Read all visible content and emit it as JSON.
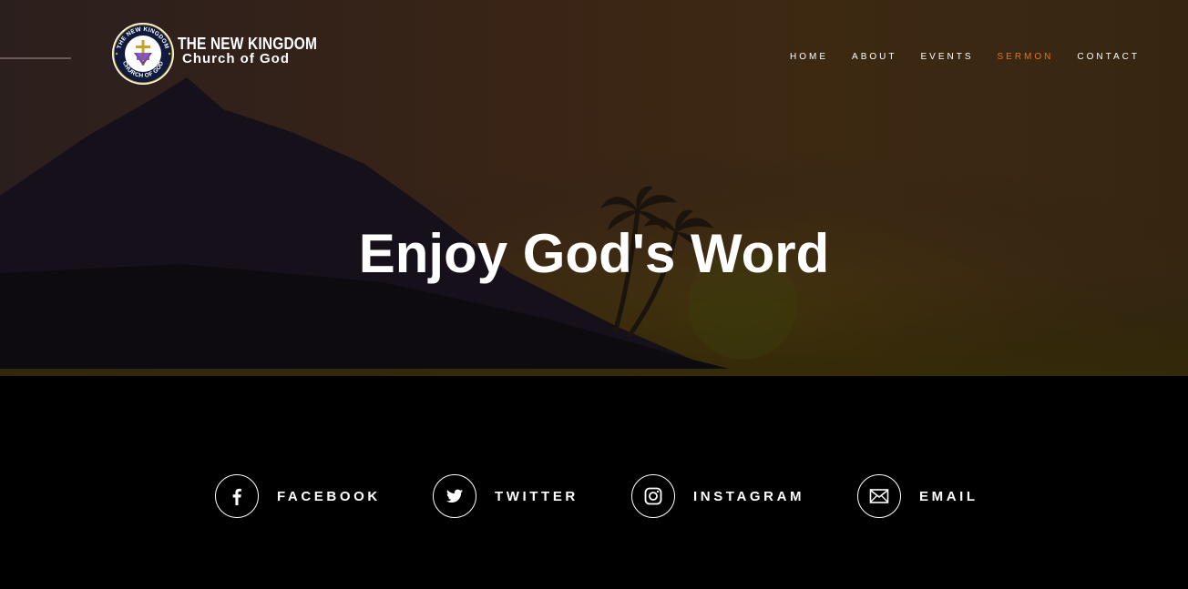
{
  "brand": {
    "line1": "THE NEW KINGDOM",
    "line2": "Church of God",
    "emblem_text": "THE NEW KINGDOM · CHURCH OF GOD"
  },
  "nav": {
    "items": [
      {
        "label": "HOME",
        "active": false
      },
      {
        "label": "ABOUT",
        "active": false
      },
      {
        "label": "EVENTS",
        "active": false
      },
      {
        "label": "SERMON",
        "active": true
      },
      {
        "label": "CONTACT",
        "active": false
      }
    ]
  },
  "hero": {
    "title": "Enjoy God's Word"
  },
  "social": {
    "items": [
      {
        "label": "FACEBOOK",
        "icon": "facebook-icon"
      },
      {
        "label": "TWITTER",
        "icon": "twitter-icon"
      },
      {
        "label": "INSTAGRAM",
        "icon": "instagram-icon"
      },
      {
        "label": "EMAIL",
        "icon": "email-icon"
      }
    ]
  },
  "colors": {
    "accent": "#e8731f",
    "background": "#000000",
    "text": "#ffffff"
  }
}
